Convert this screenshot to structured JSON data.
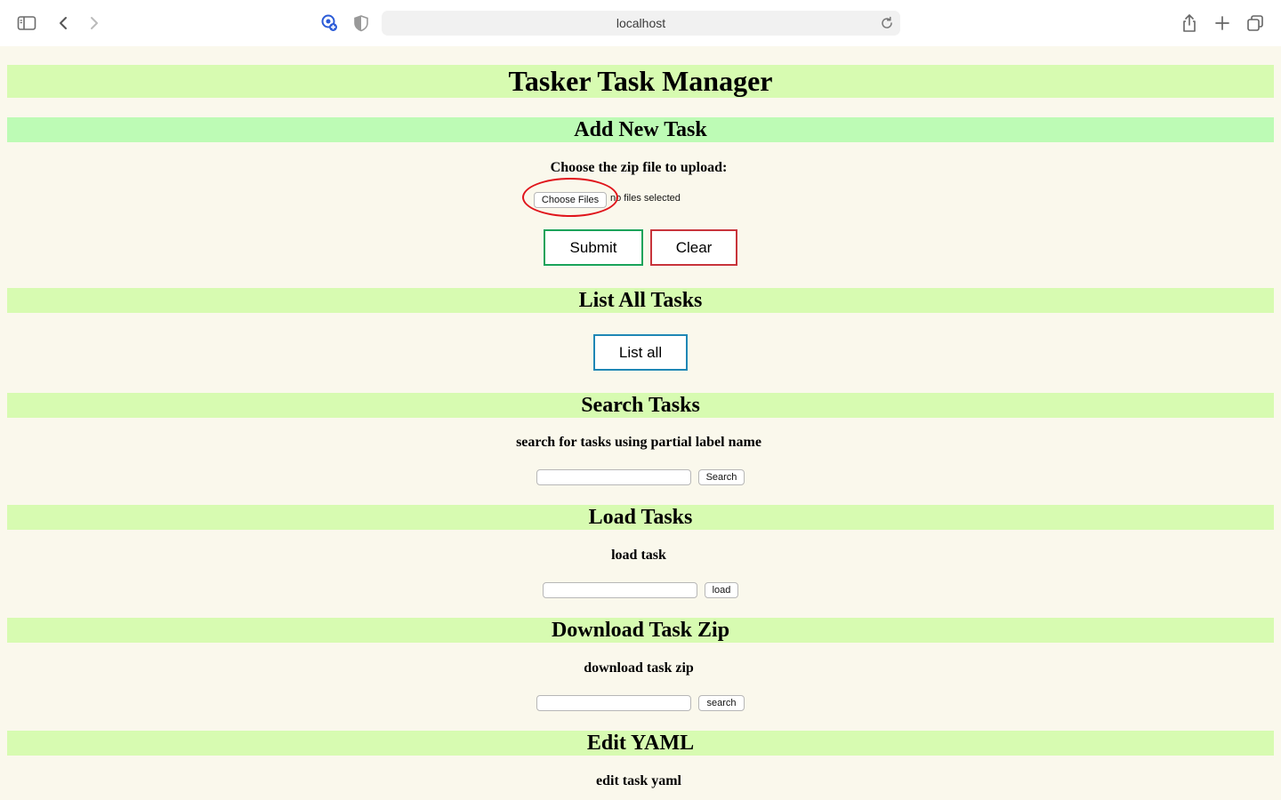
{
  "browser": {
    "url": "localhost"
  },
  "page": {
    "title": "Tasker Task Manager",
    "add_task": {
      "heading": "Add New Task",
      "prompt": "Choose the zip file to upload:",
      "choose_files_label": "Choose Files",
      "file_status": "no files selected",
      "submit_label": "Submit",
      "clear_label": "Clear"
    },
    "list_tasks": {
      "heading": "List All Tasks",
      "button_label": "List all"
    },
    "search_tasks": {
      "heading": "Search Tasks",
      "prompt": "search for tasks using partial label name",
      "input_value": "",
      "button_label": "Search"
    },
    "load_tasks": {
      "heading": "Load Tasks",
      "prompt": "load task",
      "input_value": "",
      "button_label": "load"
    },
    "download_zip": {
      "heading": "Download Task Zip",
      "prompt": "download task zip",
      "input_value": "",
      "button_label": "search"
    },
    "edit_yaml": {
      "heading": "Edit YAML",
      "prompt": "edit task yaml"
    }
  },
  "colors": {
    "page_background": "#faf8ec",
    "banner": "#d7fbb1",
    "banner_alt": "#bdfbb5",
    "submit_border": "#1aa35a",
    "clear_border": "#c8343b",
    "list_border": "#1f87b5",
    "annotation": "#e0141b"
  },
  "icons": [
    "sidebar-icon",
    "back-icon",
    "forward-icon",
    "extension-icon",
    "shield-icon",
    "reload-icon",
    "share-icon",
    "new-tab-icon",
    "tabs-overview-icon"
  ]
}
